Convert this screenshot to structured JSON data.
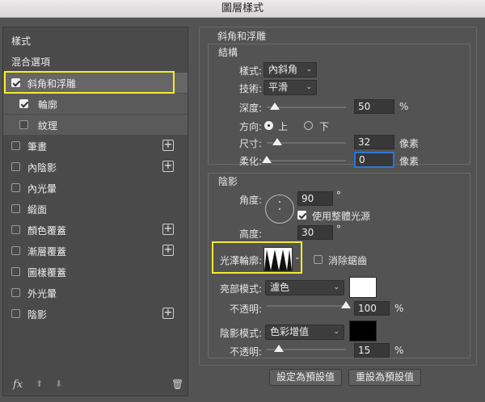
{
  "window": {
    "title": "圖層樣式"
  },
  "left_panel": {
    "header_styles": "樣式",
    "header_blend": "混合選項",
    "items": [
      {
        "label": "斜角和浮雕",
        "checked": true
      },
      {
        "label": "輪廓",
        "checked": true
      },
      {
        "label": "紋理",
        "checked": false
      },
      {
        "label": "筆畫",
        "checked": false
      },
      {
        "label": "內陰影",
        "checked": false
      },
      {
        "label": "內光暈",
        "checked": false
      },
      {
        "label": "緞面",
        "checked": false
      },
      {
        "label": "顏色覆蓋",
        "checked": false
      },
      {
        "label": "漸層覆蓋",
        "checked": false
      },
      {
        "label": "圖樣覆蓋",
        "checked": false
      },
      {
        "label": "外光暈",
        "checked": false
      },
      {
        "label": "陰影",
        "checked": false
      }
    ],
    "plus_glyph": "+",
    "footer": {
      "fx": "fx",
      "up": "⬆",
      "down": "⬇",
      "trash": "🗑"
    }
  },
  "bevel": {
    "section_title": "斜角和浮雕",
    "structure": {
      "title": "結構",
      "style_label": "樣式:",
      "style_value": "內斜角",
      "technique_label": "技術:",
      "technique_value": "平滑",
      "depth_label": "深度:",
      "depth_value": "50",
      "depth_unit": "%",
      "depth_level": 0.1,
      "direction_label": "方向:",
      "direction_up": "上",
      "direction_down": "下",
      "size_label": "尺寸:",
      "size_value": "32",
      "size_unit": "像素",
      "size_level": 0.13,
      "soften_label": "柔化:",
      "soften_value": "0",
      "soften_unit": "像素",
      "soften_level": 0.0
    },
    "shading": {
      "title": "陰影",
      "angle_label": "角度:",
      "angle_value": "90",
      "angle_unit": "°",
      "global_light_label": "使用整體光源",
      "global_light_checked": true,
      "altitude_label": "高度:",
      "altitude_value": "30",
      "altitude_unit": "°",
      "gloss_label": "光澤輪廓:",
      "anti_alias_label": "消除鋸齒",
      "anti_alias_checked": false,
      "highlight_mode_label": "亮部模式:",
      "highlight_mode_value": "濾色",
      "highlight_color": "#ffffff",
      "highlight_opacity_label": "不透明:",
      "highlight_opacity_value": "100",
      "highlight_opacity_unit": "%",
      "highlight_opacity_level": 1.0,
      "shadow_mode_label": "陰影模式:",
      "shadow_mode_value": "色彩增值",
      "shadow_color": "#000000",
      "shadow_opacity_label": "不透明:",
      "shadow_opacity_value": "15",
      "shadow_opacity_unit": "%",
      "shadow_opacity_level": 0.15
    }
  },
  "buttons": {
    "set_default": "設定為預設值",
    "reset_default": "重設為預設值"
  },
  "colors": {
    "highlight_box": "#f5ea2e",
    "focus": "#2d75d3"
  }
}
